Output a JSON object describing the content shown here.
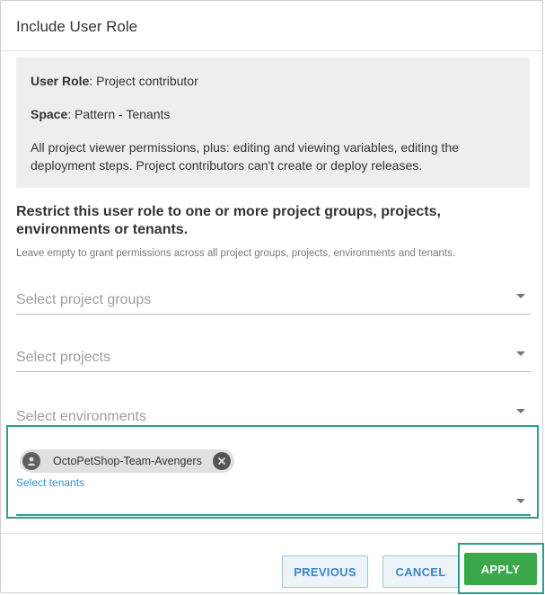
{
  "dialog": {
    "title": "Include User Role"
  },
  "info": {
    "role_label": "User Role",
    "role_value": ": Project contributor",
    "space_label": "Space",
    "space_value": ": Pattern - Tenants",
    "description": "All project viewer permissions, plus: editing and viewing variables, editing the deployment steps. Project contributors can't create or deploy releases."
  },
  "restrict": {
    "heading": "Restrict this user role to one or more project groups, projects, environments or tenants.",
    "help": "Leave empty to grant permissions across all project groups, projects, environments and tenants."
  },
  "fields": {
    "project_groups_placeholder": "Select project groups",
    "projects_placeholder": "Select projects",
    "environments_placeholder": "Select environments",
    "tenants_label": "Select tenants",
    "tenants_selected": [
      "OctoPetShop-Team-Avengers"
    ]
  },
  "buttons": {
    "previous": "PREVIOUS",
    "cancel": "CANCEL",
    "apply": "APPLY"
  },
  "colors": {
    "accent": "#2e9e8a",
    "apply": "#3aa84a",
    "link": "#2f93e0"
  },
  "icons": {
    "field_caret": "caret-down-icon",
    "chip_avatar": "tenant-avatar-icon",
    "chip_remove": "close-circle-icon"
  }
}
